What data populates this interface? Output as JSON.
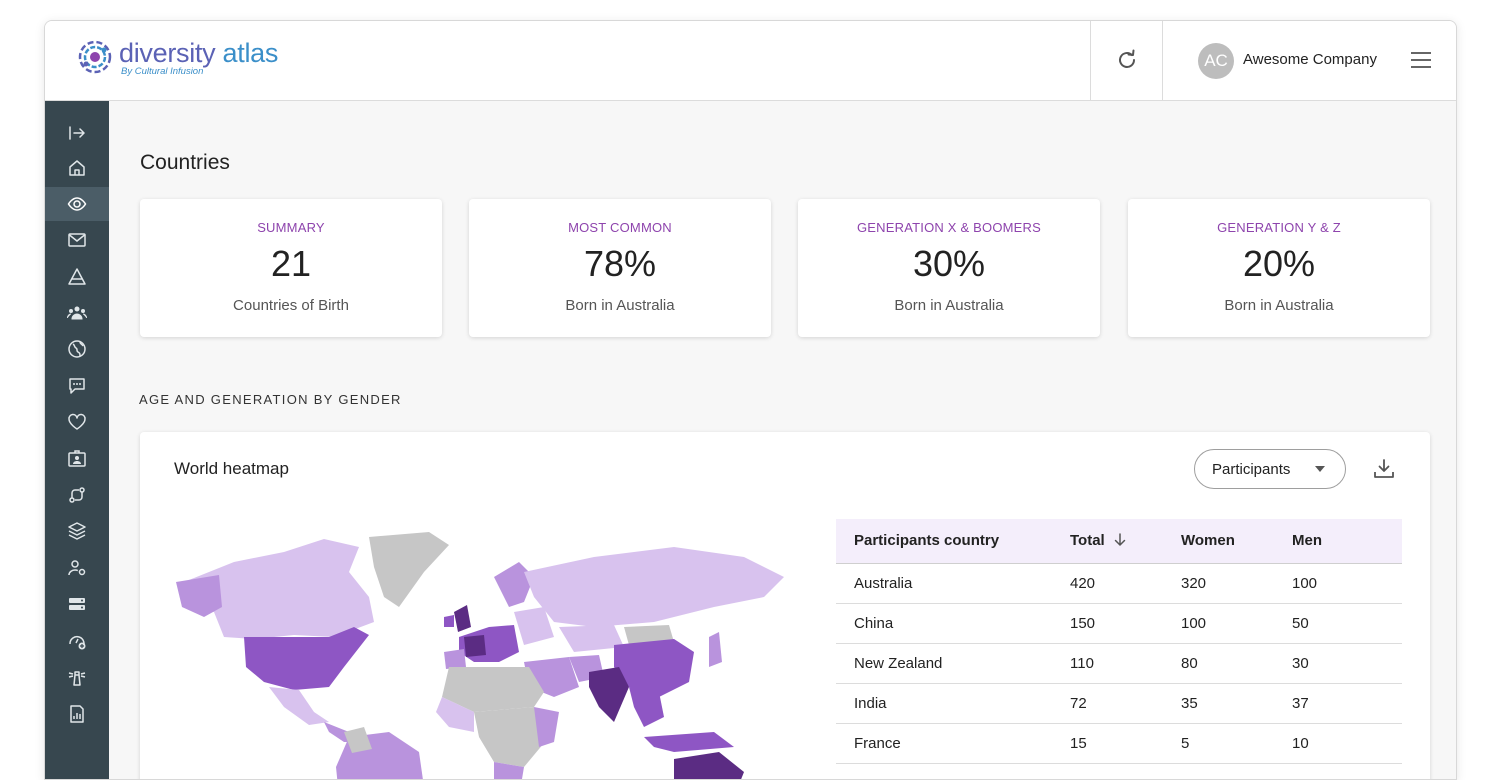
{
  "brand": {
    "name_part1": "diversity",
    "name_part2": "atlas",
    "tagline": "By Cultural Infusion",
    "logo_icon": "globe-logo-icon"
  },
  "header": {
    "refresh_icon": "refresh-icon",
    "avatar_initials": "AC",
    "company_name": "Awesome Company",
    "menu_icon": "hamburger-menu-icon"
  },
  "sidebar": {
    "items": [
      {
        "icon": "expand-sidebar-icon",
        "active": false
      },
      {
        "icon": "home-icon",
        "active": false
      },
      {
        "icon": "eye-icon",
        "active": true
      },
      {
        "icon": "mail-icon",
        "active": false
      },
      {
        "icon": "pyramid-icon",
        "active": false
      },
      {
        "icon": "group-icon",
        "active": false
      },
      {
        "icon": "globe-icon",
        "active": false
      },
      {
        "icon": "chat-icon",
        "active": false
      },
      {
        "icon": "heart-icon",
        "active": false
      },
      {
        "icon": "id-card-icon",
        "active": false
      },
      {
        "icon": "workflow-icon",
        "active": false
      },
      {
        "icon": "layers-icon",
        "active": false
      },
      {
        "icon": "user-settings-icon",
        "active": false
      },
      {
        "icon": "server-icon",
        "active": false
      },
      {
        "icon": "dashboard-add-icon",
        "active": false
      },
      {
        "icon": "lighthouse-icon",
        "active": false
      },
      {
        "icon": "report-icon",
        "active": false
      }
    ]
  },
  "page": {
    "title": "Countries",
    "cards": [
      {
        "label": "SUMMARY",
        "value": "21",
        "sub": "Countries of Birth"
      },
      {
        "label": "MOST COMMON",
        "value": "78%",
        "sub": "Born in Australia"
      },
      {
        "label": "GENERATION X & BOOMERS",
        "value": "30%",
        "sub": "Born in Australia"
      },
      {
        "label": "GENERATION Y & Z",
        "value": "20%",
        "sub": "Born in Australia"
      }
    ],
    "section_title": "AGE AND GENERATION BY GENDER"
  },
  "heatmap": {
    "title": "World heatmap",
    "dropdown_value": "Participants",
    "download_icon": "download-icon",
    "colors": {
      "high": "#5b2c83",
      "mid": "#8e56c4",
      "low": "#b993dd",
      "light": "#d8c2ee",
      "none": "#c6c6c6"
    }
  },
  "table": {
    "headers": [
      "Participants country",
      "Total",
      "Women",
      "Men"
    ],
    "sort_icon": "arrow-down-icon",
    "rows": [
      [
        "Australia",
        "420",
        "320",
        "100"
      ],
      [
        "China",
        "150",
        "100",
        "50"
      ],
      [
        "New Zealand",
        "110",
        "80",
        "30"
      ],
      [
        "India",
        "72",
        "35",
        "37"
      ],
      [
        "France",
        "15",
        "5",
        "10"
      ]
    ]
  }
}
